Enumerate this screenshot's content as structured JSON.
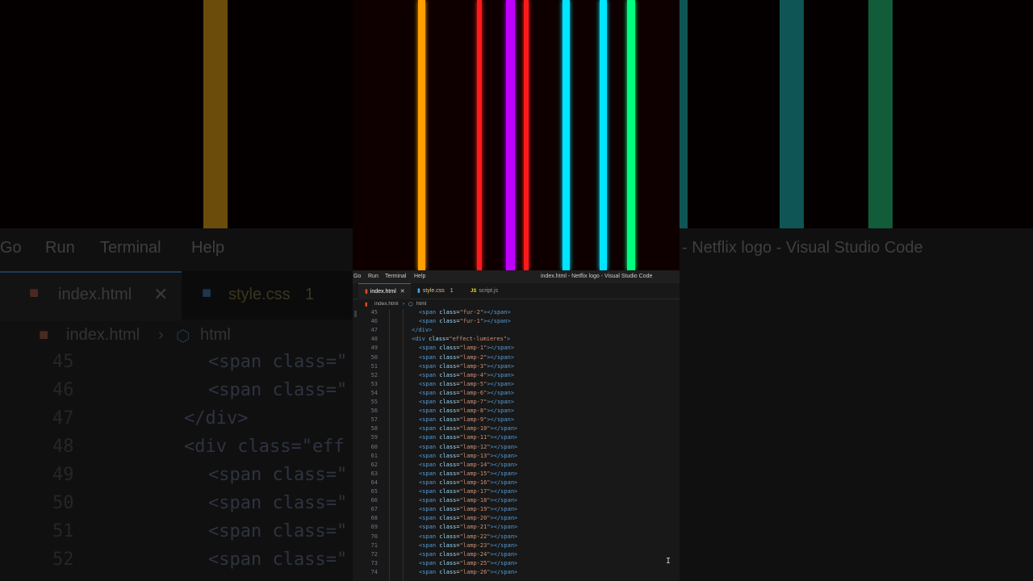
{
  "background_blur": {
    "menu": [
      "Go",
      "Run",
      "Terminal",
      "Help"
    ],
    "title": "- Netflix logo - Visual Studio Code",
    "tab_active": "index.html",
    "tab_other": "style.css",
    "tab_other_badge": "1",
    "breadcrumb_file": "index.html",
    "breadcrumb_symbol": "html",
    "code_lines": [
      {
        "num": "45",
        "text": "<span class=\""
      },
      {
        "num": "46",
        "text": "<span class=\""
      },
      {
        "num": "47",
        "text": "</div>"
      },
      {
        "num": "48",
        "text": "<div class=\"eff"
      },
      {
        "num": "49",
        "text": "<span class=\""
      },
      {
        "num": "50",
        "text": "<span class=\""
      },
      {
        "num": "51",
        "text": "<span class=\""
      },
      {
        "num": "52",
        "text": "<span class=\""
      }
    ],
    "stripe_colors": [
      "#c28a14",
      "#1a9a9a",
      "#1a9a9a",
      "#1fa86a"
    ]
  },
  "preview": {
    "lamp_colors": [
      "#ff9f00",
      "#ff1a1a",
      "#c000ff",
      "#ff1a1a",
      "#00e5ff",
      "#00e5ff",
      "#00ff7f"
    ]
  },
  "menubar": {
    "items": [
      "Go",
      "Run",
      "Terminal",
      "Help"
    ],
    "window_title": "index.html - Netflix logo - Visual Studio Code"
  },
  "tabs": [
    {
      "label": "index.html",
      "icon": "html5-icon",
      "active": true
    },
    {
      "label": "style.css",
      "icon": "css3-icon",
      "badge": "1",
      "active": false
    },
    {
      "label": "script.js",
      "icon": "js-icon",
      "active": false
    }
  ],
  "breadcrumb": {
    "file": "index.html",
    "symbol": "html"
  },
  "editor": {
    "lines": [
      {
        "num": "45",
        "indent": 2,
        "kind": "span",
        "cls": "fur-2"
      },
      {
        "num": "46",
        "indent": 2,
        "kind": "span",
        "cls": "fur-1"
      },
      {
        "num": "47",
        "indent": 1,
        "kind": "close",
        "tag": "div"
      },
      {
        "num": "48",
        "indent": 1,
        "kind": "open",
        "tag": "div",
        "cls": "effect-lumieres"
      },
      {
        "num": "49",
        "indent": 2,
        "kind": "span",
        "cls": "lamp-1"
      },
      {
        "num": "50",
        "indent": 2,
        "kind": "span",
        "cls": "lamp-2"
      },
      {
        "num": "51",
        "indent": 2,
        "kind": "span",
        "cls": "lamp-3"
      },
      {
        "num": "52",
        "indent": 2,
        "kind": "span",
        "cls": "lamp-4"
      },
      {
        "num": "53",
        "indent": 2,
        "kind": "span",
        "cls": "lamp-5"
      },
      {
        "num": "54",
        "indent": 2,
        "kind": "span",
        "cls": "lamp-6"
      },
      {
        "num": "55",
        "indent": 2,
        "kind": "span",
        "cls": "lamp-7"
      },
      {
        "num": "56",
        "indent": 2,
        "kind": "span",
        "cls": "lamp-8"
      },
      {
        "num": "57",
        "indent": 2,
        "kind": "span",
        "cls": "lamp-9"
      },
      {
        "num": "58",
        "indent": 2,
        "kind": "span",
        "cls": "lamp-10"
      },
      {
        "num": "59",
        "indent": 2,
        "kind": "span",
        "cls": "lamp-11"
      },
      {
        "num": "60",
        "indent": 2,
        "kind": "span",
        "cls": "lamp-12"
      },
      {
        "num": "61",
        "indent": 2,
        "kind": "span",
        "cls": "lamp-13"
      },
      {
        "num": "62",
        "indent": 2,
        "kind": "span",
        "cls": "lamp-14"
      },
      {
        "num": "63",
        "indent": 2,
        "kind": "span",
        "cls": "lamp-15"
      },
      {
        "num": "64",
        "indent": 2,
        "kind": "span",
        "cls": "lamp-16"
      },
      {
        "num": "65",
        "indent": 2,
        "kind": "span",
        "cls": "lamp-17"
      },
      {
        "num": "66",
        "indent": 2,
        "kind": "span",
        "cls": "lamp-18"
      },
      {
        "num": "67",
        "indent": 2,
        "kind": "span",
        "cls": "lamp-19"
      },
      {
        "num": "68",
        "indent": 2,
        "kind": "span",
        "cls": "lamp-20"
      },
      {
        "num": "69",
        "indent": 2,
        "kind": "span",
        "cls": "lamp-21"
      },
      {
        "num": "70",
        "indent": 2,
        "kind": "span",
        "cls": "lamp-22"
      },
      {
        "num": "71",
        "indent": 2,
        "kind": "span",
        "cls": "lamp-23"
      },
      {
        "num": "72",
        "indent": 2,
        "kind": "span",
        "cls": "lamp-24"
      },
      {
        "num": "73",
        "indent": 2,
        "kind": "span",
        "cls": "lamp-25"
      },
      {
        "num": "74",
        "indent": 2,
        "kind": "span",
        "cls": "lamp-26"
      }
    ]
  }
}
